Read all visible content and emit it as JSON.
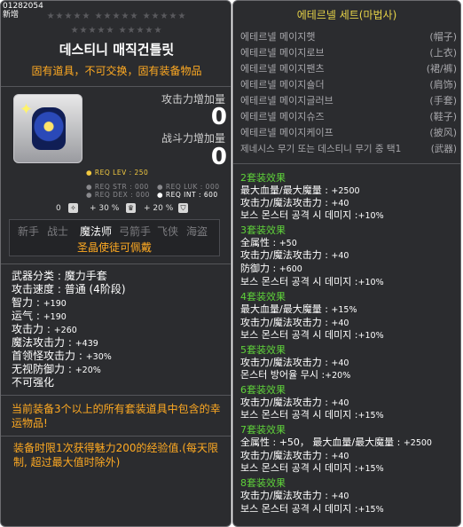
{
  "item": {
    "id_line": "01282054",
    "new_tag": "新增",
    "title": "데스티니 매직건틀릿",
    "subtitle": "固有道具，不可交换，固有装备物品",
    "attack_label": "攻击力增加量",
    "attack_value": "0",
    "combat_label": "战斗力增加量",
    "combat_value": "0",
    "req_lev": "● REQ LEV : 250",
    "req_str": "● REQ STR : 000",
    "req_luk": "● REQ LUK : 000",
    "req_dex": "● REQ DEX : 000",
    "req_int": "● REQ INT : 600",
    "opt1_value": "0",
    "opt2_value": "+ 30 %",
    "opt3_value": "+ 20 %",
    "jobs": [
      "新手",
      "战士",
      "魔法师",
      "弓箭手",
      "飞侠",
      "海盗"
    ],
    "job_note": "圣晶使徒可佩戴",
    "stats": [
      {
        "label": "武器分类 :",
        "value": "魔力手套"
      },
      {
        "label": "攻击速度 :",
        "value": "普通 (4阶段)"
      },
      {
        "label": "智力 :",
        "value": "+190"
      },
      {
        "label": "运气 :",
        "value": "+190"
      },
      {
        "label": "攻击力 :",
        "value": "+260"
      },
      {
        "label": "魔法攻击力 :",
        "value": "+439"
      },
      {
        "label": "首领怪攻击力 :",
        "value": "+30%"
      },
      {
        "label": "无视防御力 :",
        "value": "+20%"
      },
      {
        "label": "不可强化",
        "value": ""
      }
    ],
    "note1": "当前装备3个以上的所有套装道具中包含的幸运物品!",
    "note2": "装备时限1次获得魅力200的经验值.(每天限制, 超过最大值时除外)"
  },
  "set": {
    "title": "에테르넬 세트(마법사)",
    "pieces": [
      {
        "name": "에테르넬 메이지햇",
        "kind": "(帽子)"
      },
      {
        "name": "에테르넬 메이지로브",
        "kind": "(上衣)"
      },
      {
        "name": "에테르넬 메이지팬츠",
        "kind": "(裙/裤)"
      },
      {
        "name": "에테르넬 메이지숄더",
        "kind": "(肩饰)"
      },
      {
        "name": "에테르넬 메이지글러브",
        "kind": "(手套)"
      },
      {
        "name": "에테르넬 메이지슈즈",
        "kind": "(鞋子)"
      },
      {
        "name": "에테르넬 메이지케이프",
        "kind": "(披风)"
      },
      {
        "name": "제네시스 무기 또는 데스티니 무기 중 택1",
        "kind": "(武器)"
      }
    ],
    "effects": [
      {
        "head": "2套装效果",
        "lines": [
          {
            "label": "最大血量/最大魔量 :",
            "value": "+2500"
          },
          {
            "label": "攻击力/魔法攻击力 :",
            "value": "+40"
          },
          {
            "label": "보스 몬스터 공격 시 데미지 :",
            "value": "+10%"
          }
        ]
      },
      {
        "head": "3套装效果",
        "lines": [
          {
            "label": "全属性 :",
            "value": "+50"
          },
          {
            "label": "攻击力/魔法攻击力 :",
            "value": "+40"
          },
          {
            "label": "防御力 :",
            "value": "+600"
          },
          {
            "label": "보스 몬스터 공격 시 데미지 :",
            "value": "+10%"
          }
        ]
      },
      {
        "head": "4套装效果",
        "lines": [
          {
            "label": "最大血量/最大魔量 :",
            "value": "+15%"
          },
          {
            "label": "攻击力/魔法攻击力 :",
            "value": "+40"
          },
          {
            "label": "보스 몬스터 공격 시 데미지 :",
            "value": "+10%"
          }
        ]
      },
      {
        "head": "5套装效果",
        "lines": [
          {
            "label": "攻击力/魔法攻击力 :",
            "value": "+40"
          },
          {
            "label": "몬스터 방어율 무시 :",
            "value": "+20%"
          }
        ]
      },
      {
        "head": "6套装效果",
        "lines": [
          {
            "label": "攻击力/魔法攻击力 :",
            "value": "+40"
          },
          {
            "label": "보스 몬스터 공격 시 데미지 :",
            "value": "+15%"
          }
        ]
      },
      {
        "head": "7套装效果",
        "lines": [
          {
            "label": "全属性 : +50， 最大血量/最大魔量 :",
            "value": "+2500"
          },
          {
            "label": "攻击力/魔法攻击力 :",
            "value": "+40"
          },
          {
            "label": "보스 몬스터 공격 시 데미지 :",
            "value": "+15%"
          }
        ]
      },
      {
        "head": "8套装效果",
        "lines": [
          {
            "label": "攻击力/魔法攻击力 :",
            "value": "+40"
          },
          {
            "label": "보스 몬스터 공격 시 데미지 :",
            "value": "+15%"
          }
        ]
      }
    ]
  },
  "colors": {
    "panel": "#2b2c2f",
    "accent_orange": "#ffaa22",
    "set_green": "#5fd33a",
    "set_title": "#e8d448"
  }
}
